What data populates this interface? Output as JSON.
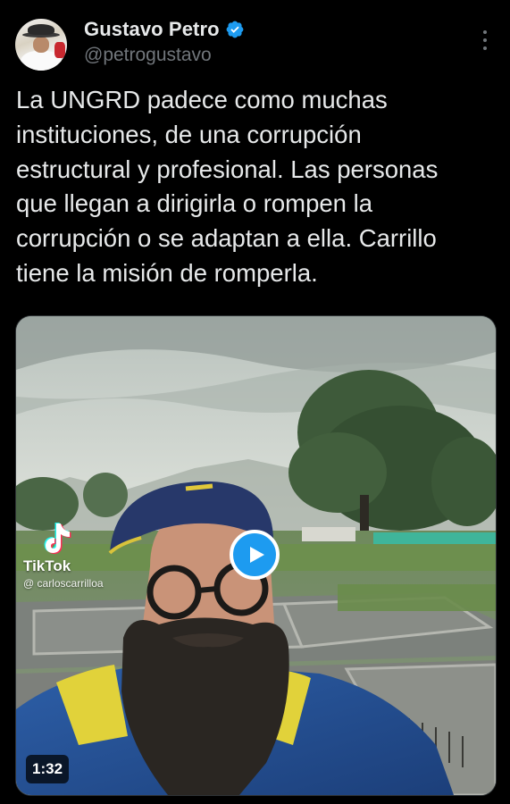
{
  "author": {
    "display_name": "Gustavo Petro",
    "handle": "@petrogustavo",
    "verified": true,
    "avatar_icon": "profile-photo",
    "verified_icon": "verified-badge-icon",
    "verified_color": "#1d9bf0"
  },
  "menu": {
    "icon": "more-options-icon"
  },
  "tweet": {
    "text": "La UNGRD padece  como muchas\ninstituciones, de una corrupción\nestructural y profesional. Las personas\nque llegan a dirigirla o rompen la\ncorrupción o se adaptan a ella. Carrillo\ntiene la misión de romperla."
  },
  "media": {
    "type": "video",
    "watermark_brand": "TikTok",
    "watermark_user": "@ carloscarrilloa",
    "duration": "1:32",
    "play_icon": "play-icon",
    "accent_color": "#1d9bf0"
  },
  "theme": {
    "background": "#000000",
    "text_primary": "#e7e9ea",
    "text_secondary": "#71767b"
  }
}
